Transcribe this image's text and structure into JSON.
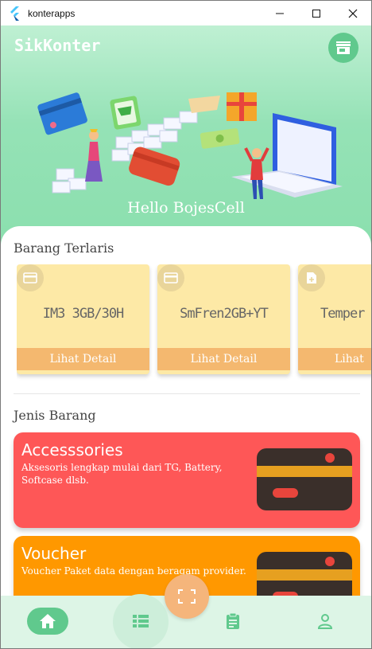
{
  "window": {
    "title": "konterapps",
    "minimize_symbol": "—",
    "maximize_symbol": "☐",
    "close_symbol": "✕"
  },
  "header": {
    "brand": "SikKonter",
    "greeting": "Hello BojesCell",
    "store_icon": "storefront-icon"
  },
  "bestseller": {
    "title": "Barang Terlaris",
    "items": [
      {
        "name": "IM3 3GB/30H",
        "button": "Lihat Detail",
        "icon": "card-icon"
      },
      {
        "name": "SmFren2GB+YT",
        "button": "Lihat Detail",
        "icon": "card-icon"
      },
      {
        "name": "Temper",
        "button": "Lihat",
        "icon": "add-document-icon"
      }
    ]
  },
  "categories": {
    "title": "Jenis Barang",
    "items": [
      {
        "title": "Accesssories",
        "desc": "Aksesoris lengkap mulai dari TG, Battery, Softcase dlsb.",
        "color": "#fe5757"
      },
      {
        "title": "Voucher",
        "desc": "Voucher Paket data dengan beragam provider.",
        "color": "#ff9800"
      }
    ]
  },
  "nav": {
    "items": [
      "home-icon",
      "list-icon",
      "scan-icon",
      "clipboard-icon",
      "person-icon"
    ]
  },
  "colors": {
    "accent": "#60c98d",
    "card_bg": "#fde9a6",
    "card_button": "#f4b86f",
    "fab": "#f5b57b"
  }
}
